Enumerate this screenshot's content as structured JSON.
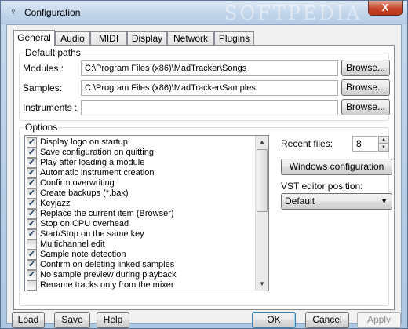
{
  "window": {
    "title": "Configuration",
    "watermark": "SOFTPEDIA",
    "close_glyph": "X"
  },
  "tabs": [
    "General",
    "Audio",
    "MIDI",
    "Display",
    "Network",
    "Plugins"
  ],
  "active_tab": "General",
  "default_paths": {
    "label": "Default paths",
    "rows": [
      {
        "label": "Modules :",
        "value": "C:\\Program Files (x86)\\MadTracker\\Songs",
        "button": "Browse..."
      },
      {
        "label": "Samples:",
        "value": "C:\\Program Files (x86)\\MadTracker\\Samples",
        "button": "Browse..."
      },
      {
        "label": "Instruments :",
        "value": "",
        "button": "Browse..."
      }
    ]
  },
  "options": {
    "label": "Options",
    "items": [
      {
        "label": "Display logo on startup",
        "checked": true
      },
      {
        "label": "Save configuration on quitting",
        "checked": true
      },
      {
        "label": "Play after loading a module",
        "checked": true
      },
      {
        "label": "Automatic instrument creation",
        "checked": true
      },
      {
        "label": "Confirm overwriting",
        "checked": true
      },
      {
        "label": "Create backups (*.bak)",
        "checked": true
      },
      {
        "label": "Keyjazz",
        "checked": true
      },
      {
        "label": "Replace the current item (Browser)",
        "checked": true
      },
      {
        "label": "Stop on CPU overhead",
        "checked": true
      },
      {
        "label": "Start/Stop on the same key",
        "checked": true
      },
      {
        "label": "Multichannel edit",
        "checked": false
      },
      {
        "label": "Sample note detection",
        "checked": true
      },
      {
        "label": "Confirm on deleting linked samples",
        "checked": true
      },
      {
        "label": "No sample preview during playback",
        "checked": true
      },
      {
        "label": "Rename tracks only from the mixer",
        "checked": false
      }
    ],
    "recent_files_label": "Recent files:",
    "recent_files_value": "8",
    "windows_config_button": "Windows configuration",
    "vst_label": "VST editor position:",
    "vst_value": "Default"
  },
  "footer": {
    "load": "Load",
    "save": "Save",
    "help": "Help",
    "ok": "OK",
    "cancel": "Cancel",
    "apply": "Apply"
  },
  "colors": {
    "accent": "#3c7fb1",
    "close": "#c7452a",
    "check": "#1f3b68"
  }
}
